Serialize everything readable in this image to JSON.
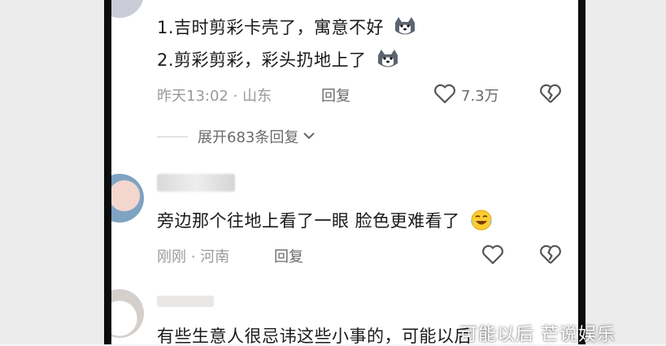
{
  "comments": [
    {
      "lines": [
        "1.吉时剪彩卡壳了，寓意不好",
        "2.剪彩剪彩，彩头扔地上了"
      ],
      "time": "昨天13:02",
      "location": "山东",
      "reply_label": "回复",
      "likes": "7.3万",
      "expand_label": "展开683条回复"
    },
    {
      "lines": [
        "旁边那个往地上看了一眼 脸色更难看了"
      ],
      "time": "刚刚",
      "location": "河南",
      "reply_label": "回复"
    },
    {
      "lines": [
        "有些生意人很忌讳这些小事的，可能以后"
      ]
    }
  ],
  "separator": " · ",
  "watermark": "可能以后 芒说娱乐",
  "icons": {
    "emoji_1": "husky-dog-emoji",
    "emoji_2": "crying-laughing-emoji",
    "like": "heart-outline-icon",
    "dislike": "broken-heart-icon",
    "expand": "chevron-down-icon"
  }
}
